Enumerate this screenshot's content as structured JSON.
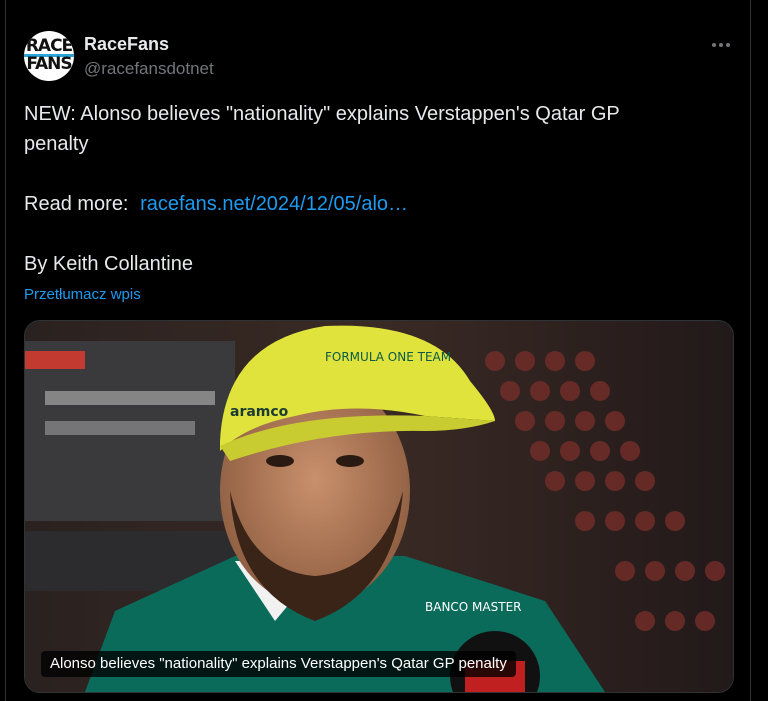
{
  "author": {
    "name": "RaceFans",
    "handle": "@racefansdotnet",
    "avatar_line1": "RACE",
    "avatar_line2": "FANS"
  },
  "tweet": {
    "line1": "NEW: Alonso believes \"nationality\" explains Verstappen's Qatar GP",
    "line2": "penalty",
    "read_more_label": "Read more:",
    "link_text": "racefans.net/2024/12/05/alo…",
    "byline": "By Keith Collantine",
    "translate_label": "Przetłumacz wpis"
  },
  "media": {
    "cap_text": "FORMULA ONE TEAM",
    "sponsor_left": "aramco",
    "sponsor_right": "BANCO MASTER",
    "caption": "Alonso believes \"nationality\" explains Verstappen's Qatar GP penalty"
  },
  "colors": {
    "accent_link": "#1d9bf0",
    "text": "#e7e9ea",
    "muted": "#71767b",
    "cap": "#dfe33b",
    "shirt": "#0b6b5a"
  },
  "icons": {
    "more": "more-dots-icon"
  }
}
